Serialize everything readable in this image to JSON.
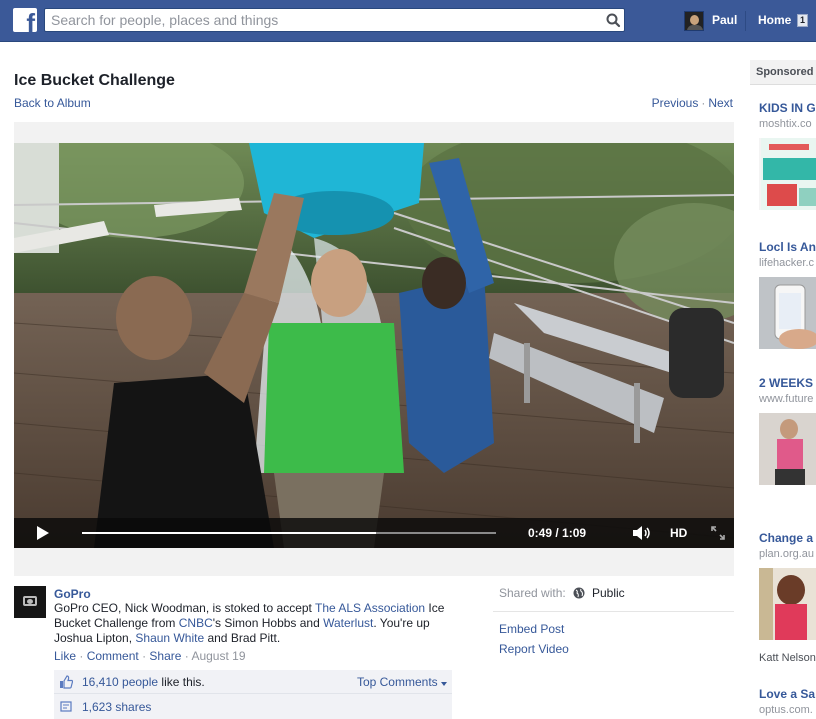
{
  "header": {
    "logo_letter": "f",
    "search_placeholder": "Search for people, places and things",
    "user_name": "Paul",
    "home_label": "Home",
    "home_badge": "1"
  },
  "album": {
    "title": "Ice Bucket Challenge",
    "back_label": "Back to Album",
    "previous_label": "Previous",
    "next_label": "Next",
    "nav_separator": "·"
  },
  "video": {
    "time": "0:49 / 1:09",
    "progress": 0.71,
    "hd_label": "HD"
  },
  "post": {
    "page_name": "GoPro",
    "caption_parts": [
      {
        "text": "GoPro CEO, Nick Woodman, is stoked to accept ",
        "link": false
      },
      {
        "text": "The ALS Association",
        "link": true
      },
      {
        "text": " Ice Bucket Challenge from ",
        "link": false
      },
      {
        "text": "CNBC",
        "link": true
      },
      {
        "text": "'s Simon Hobbs and ",
        "link": false
      },
      {
        "text": "Waterlust",
        "link": true
      },
      {
        "text": ". You're up Joshua Lipton, ",
        "link": false
      },
      {
        "text": "Shaun White",
        "link": true
      },
      {
        "text": " and Brad Pitt.",
        "link": false
      }
    ],
    "actions": {
      "like": "Like",
      "comment": "Comment",
      "share": "Share",
      "separator": "·",
      "date": "August 19"
    },
    "likes_count": "16,410 people",
    "likes_suffix": " like this.",
    "top_comments": "Top Comments",
    "shares": "1,623 shares"
  },
  "meta": {
    "shared_with_label": "Shared with:",
    "privacy": "Public",
    "embed_post": "Embed Post",
    "report_video": "Report Video"
  },
  "sidebar": {
    "sponsored_label": "Sponsored",
    "ads": [
      {
        "title": "KIDS IN G",
        "domain": "moshtix.co"
      },
      {
        "title": "Locl Is An",
        "domain": "lifehacker.c"
      },
      {
        "title": "2 WEEKS",
        "domain": "www.future"
      },
      {
        "title": "Change a",
        "domain": "plan.org.au"
      },
      {
        "title": "Love a Sa",
        "domain": "optus.com."
      }
    ],
    "ad4_extra": "Katt Nelson"
  },
  "colors": {
    "brand_blue": "#3b5998",
    "link_blue": "#365899",
    "muted_gray": "#90949c"
  },
  "icons": [
    "facebook-logo",
    "search-icon",
    "play-icon",
    "volume-icon",
    "fullscreen-icon",
    "like-thumb-icon",
    "share-icon",
    "globe-icon",
    "chevron-down-icon"
  ]
}
